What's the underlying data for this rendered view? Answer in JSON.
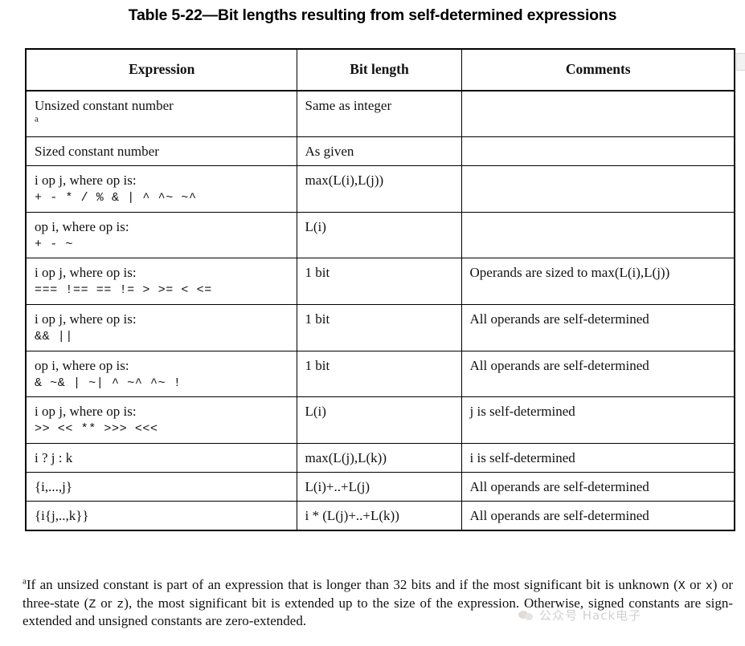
{
  "title": "Table 5-22—Bit lengths resulting from self-determined expressions",
  "table": {
    "headers": {
      "expression": "Expression",
      "bit_length": "Bit length",
      "comments": "Comments"
    },
    "rows": [
      {
        "expression": "Unsized constant number",
        "expression_footnote": "a",
        "operators": "",
        "bit_length": "Same as integer",
        "comments": ""
      },
      {
        "expression": "Sized constant number",
        "expression_footnote": "",
        "operators": "",
        "bit_length": "As given",
        "comments": ""
      },
      {
        "expression": "i op j, where op is:",
        "expression_footnote": "",
        "operators": "+ - * / % & | ^ ^~ ~^",
        "bit_length": "max(L(i),L(j))",
        "comments": ""
      },
      {
        "expression": "op i, where op is:",
        "expression_footnote": "",
        "operators": "+ - ~",
        "bit_length": "L(i)",
        "comments": ""
      },
      {
        "expression": "i op j, where op is:",
        "expression_footnote": "",
        "operators": "=== !== == != > >= < <=",
        "bit_length": "1 bit",
        "comments": "Operands are sized to max(L(i),L(j))"
      },
      {
        "expression": "i op j, where op is:",
        "expression_footnote": "",
        "operators": "&& ||",
        "bit_length": "1 bit",
        "comments": "All operands are self-determined"
      },
      {
        "expression": "op i, where op is:",
        "expression_footnote": "",
        "operators": "& ~& | ~| ^ ~^ ^~ !",
        "bit_length": "1 bit",
        "comments": "All operands are self-determined"
      },
      {
        "expression": "i op j, where op is:",
        "expression_footnote": "",
        "operators": ">> << ** >>> <<<",
        "bit_length": "L(i)",
        "comments": "j is self-determined"
      },
      {
        "expression": "i ? j : k",
        "expression_footnote": "",
        "operators": "",
        "bit_length": "max(L(j),L(k))",
        "comments": "i is self-determined"
      },
      {
        "expression": "{i,...,j}",
        "expression_footnote": "",
        "operators": "",
        "bit_length": "L(i)+..+L(j)",
        "comments": "All operands are self-determined"
      },
      {
        "expression": "{i{j,..,k}}",
        "expression_footnote": "",
        "operators": "",
        "bit_length": "i * (L(j)+..+L(k))",
        "comments": "All operands are self-determined"
      }
    ]
  },
  "footnote": {
    "marker": "a",
    "part1": "If an unsized constant is part of an expression that is longer than 32 bits and if the most significant bit is unknown (",
    "mono1": "X",
    "part2": " or ",
    "mono2": "x",
    "part3": ") or three-state (",
    "mono3": "Z",
    "part4": " or ",
    "mono4": "z",
    "part5": "), the most significant bit is extended up to the size of the expression. Otherwise, signed constants are sign-extended and unsigned constants are zero-extended."
  },
  "watermark": {
    "text": "公众号 Hack电子"
  }
}
